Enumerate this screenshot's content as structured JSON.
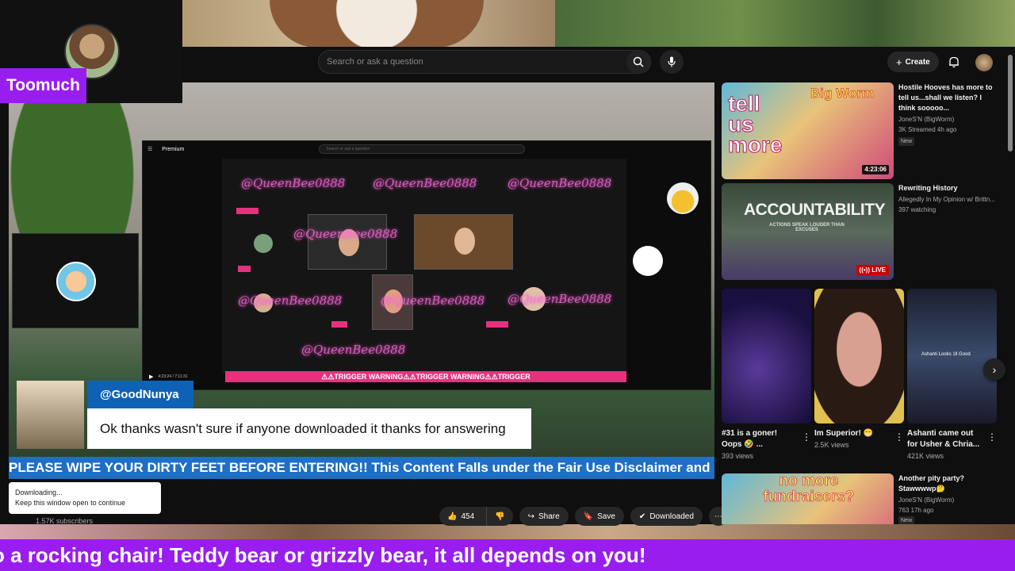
{
  "streamer": {
    "name": "Toomuch"
  },
  "search": {
    "placeholder": "Search or ask a question"
  },
  "header": {
    "create_label": "Create"
  },
  "inner_stream": {
    "logo": "Premium",
    "search_placeholder": "Search or ask a question",
    "watermark": "@QueenBee0888",
    "trigger_text": "⚠⚠TRIGGER WARNING⚠⚠TRIGGER WARNING⚠⚠TRIGGER",
    "time": "4:23:24 / 7:11:31"
  },
  "chat": {
    "username": "@GoodNunya",
    "message": "Ok thanks wasn't sure if anyone downloaded it thanks for answering"
  },
  "ticker": {
    "text": "PLEASE WIPE YOUR DIRTY FEET BEFORE ENTERING!! This Content Falls under the Fair Use Disclaimer and"
  },
  "channel": {
    "subscribers": "1.57K subscribers"
  },
  "actions": {
    "like_count": "454",
    "share_label": "Share",
    "save_label": "Save",
    "download_label": "Downloaded"
  },
  "toast": {
    "line1": "Downloading...",
    "line2": "Keep this window open to continue"
  },
  "recommendations": [
    {
      "title": "Hostile Hooves has more to tell us...shall we listen? I think sooooo...",
      "channel": "JoneS'N (BigWorm)",
      "meta": "3K  Streamed 4h ago",
      "badge": "New",
      "duration": "4:23:06",
      "thumb_text": "tell us more",
      "thumb_sub": "Big Worm"
    },
    {
      "title": "Rewriting History",
      "channel": "Allegedly In My Opinion w/ Brittn...",
      "meta": "397 watching",
      "live": "LIVE",
      "thumb_text": "ACCOUNTABILITY",
      "thumb_sub": "ACTIONS SPEAK LOUDER THAN EXCUSES"
    },
    {
      "title": "Another pity party? Stawwwwp🤔",
      "channel": "JoneS'N (BigWorm)",
      "meta": "763  17h ago",
      "badge": "New",
      "thumb_text": "no more fundraisers?"
    }
  ],
  "shorts": [
    {
      "title": "#31 is a goner! Oops 🤣 ...",
      "views": "393 views"
    },
    {
      "title": "Im Superior! 😁",
      "views": "2.5K views"
    },
    {
      "title": "Ashanti came out for Usher & Chria...",
      "views": "421K views",
      "overlay": "Ashanti Looks 1ll Good"
    }
  ],
  "marquee": {
    "text": "o a rocking chair! Teddy bear or grizzly bear, it all depends on you!"
  },
  "colors": {
    "accent_purple": "#9a1df0",
    "chat_blue": "#0e61b5",
    "ticker_blue": "#1f6fc4",
    "trigger_pink": "#e8307d",
    "live_red": "#cc0000"
  }
}
